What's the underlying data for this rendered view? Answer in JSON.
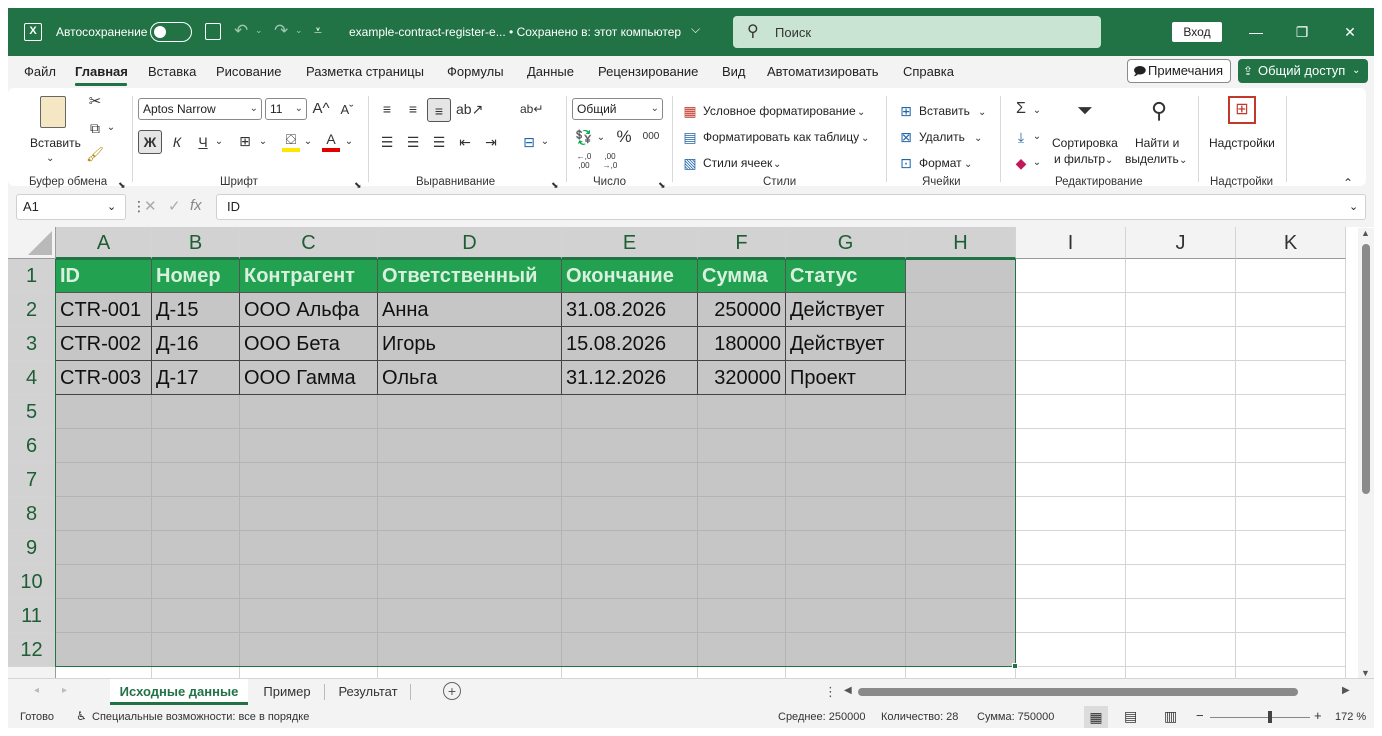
{
  "titlebar": {
    "autosave_label": "Автосохранение",
    "doc_title": "example-contract-register-e... • Сохранено в: этот компьютер",
    "search_placeholder": "Поиск",
    "signin_label": "Вход"
  },
  "menu": {
    "tabs": [
      "Файл",
      "Главная",
      "Вставка",
      "Рисование",
      "Разметка страницы",
      "Формулы",
      "Данные",
      "Рецензирование",
      "Вид",
      "Автоматизировать",
      "Справка"
    ],
    "active_tab": "Главная",
    "notes_label": "Примечания",
    "share_label": "Общий доступ"
  },
  "ribbon": {
    "clipboard": {
      "label": "Буфер обмена",
      "paste": "Вставить"
    },
    "font": {
      "label": "Шрифт",
      "font_name": "Aptos Narrow",
      "font_size": "11",
      "bold": "Ж",
      "italic": "К",
      "underline": "Ч"
    },
    "alignment": {
      "label": "Выравнивание"
    },
    "number": {
      "label": "Число",
      "format": "Общий",
      "percent": "%",
      "thousands": "000",
      "inc_decimal": "←,0 ,00",
      "dec_decimal": ",00 →,0"
    },
    "styles": {
      "label": "Стили",
      "conditional": "Условное форматирование",
      "as_table": "Форматировать как таблицу",
      "cell_styles": "Стили ячеек"
    },
    "cells": {
      "label": "Ячейки",
      "insert": "Вставить",
      "delete": "Удалить",
      "format": "Формат"
    },
    "editing": {
      "label": "Редактирование",
      "sort1": "Сортировка",
      "sort2": "и фильтр",
      "find1": "Найти и",
      "find2": "выделить"
    },
    "addins": {
      "label": "Надстройки",
      "button": "Надстройки"
    }
  },
  "formula_bar": {
    "name_box": "A1",
    "fx": "fx",
    "value": "ID"
  },
  "grid": {
    "columns": [
      "A",
      "B",
      "C",
      "D",
      "E",
      "F",
      "G",
      "H",
      "I",
      "J",
      "K"
    ],
    "rows": [
      "1",
      "2",
      "3",
      "4",
      "5",
      "6",
      "7",
      "8",
      "9",
      "10",
      "11",
      "12"
    ],
    "header": [
      "ID",
      "Номер",
      "Контрагент",
      "Ответственный",
      "Окончание",
      "Сумма",
      "Статус"
    ],
    "data": [
      [
        "CTR-001",
        "Д-15",
        "ООО Альфа",
        "Анна",
        "31.08.2026",
        "250000",
        "Действует"
      ],
      [
        "CTR-002",
        "Д-16",
        "ООО Бета",
        "Игорь",
        "15.08.2026",
        "180000",
        "Действует"
      ],
      [
        "CTR-003",
        "Д-17",
        "ООО Гамма",
        "Ольга",
        "31.12.2026",
        "320000",
        "Проект"
      ]
    ]
  },
  "sheets": {
    "tabs": [
      "Исходные данные",
      "Пример",
      "Результат"
    ],
    "active": "Исходные данные"
  },
  "status": {
    "ready": "Готово",
    "accessibility": "Специальные возможности: все в порядке",
    "average": "Среднее: 250000",
    "count": "Количество: 28",
    "sum": "Сумма: 750000",
    "zoom": "172 %"
  },
  "colors": {
    "accent": "#217346",
    "header_fill": "#22a150",
    "selection": "#c6c6c6"
  }
}
